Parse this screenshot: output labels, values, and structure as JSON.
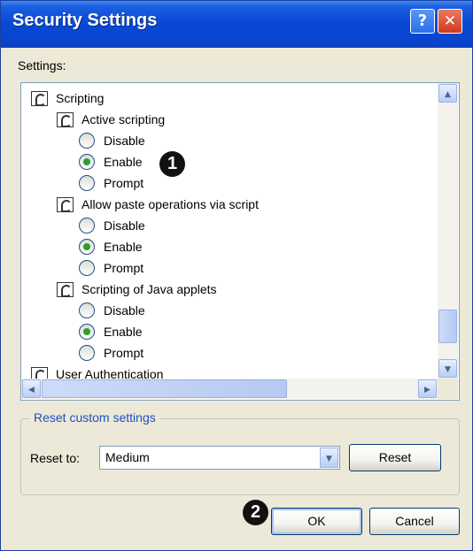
{
  "window": {
    "title": "Security Settings"
  },
  "titlebar": {
    "help_label": "?",
    "close_label": "✕"
  },
  "settings_label": "Settings:",
  "tree": [
    {
      "kind": "category",
      "label": "Scripting"
    },
    {
      "kind": "setting",
      "label": "Active scripting"
    },
    {
      "kind": "option",
      "label": "Disable",
      "selected": false
    },
    {
      "kind": "option",
      "label": "Enable",
      "selected": true
    },
    {
      "kind": "option",
      "label": "Prompt",
      "selected": false
    },
    {
      "kind": "setting",
      "label": "Allow paste operations via script"
    },
    {
      "kind": "option",
      "label": "Disable",
      "selected": false
    },
    {
      "kind": "option",
      "label": "Enable",
      "selected": true
    },
    {
      "kind": "option",
      "label": "Prompt",
      "selected": false
    },
    {
      "kind": "setting",
      "label": "Scripting of Java applets"
    },
    {
      "kind": "option",
      "label": "Disable",
      "selected": false
    },
    {
      "kind": "option",
      "label": "Enable",
      "selected": true
    },
    {
      "kind": "option",
      "label": "Prompt",
      "selected": false
    },
    {
      "kind": "category",
      "label": "User Authentication"
    }
  ],
  "scrollbars": {
    "up": "▲",
    "down": "▼",
    "left": "◀",
    "right": "▶"
  },
  "reset_group": {
    "title": "Reset custom settings",
    "reset_to_label": "Reset to:",
    "combo_value": "Medium",
    "combo_arrow": "▼",
    "reset_button": "Reset"
  },
  "footer": {
    "ok": "OK",
    "cancel": "Cancel"
  },
  "annotations": {
    "badge1": "1",
    "badge2": "2"
  }
}
